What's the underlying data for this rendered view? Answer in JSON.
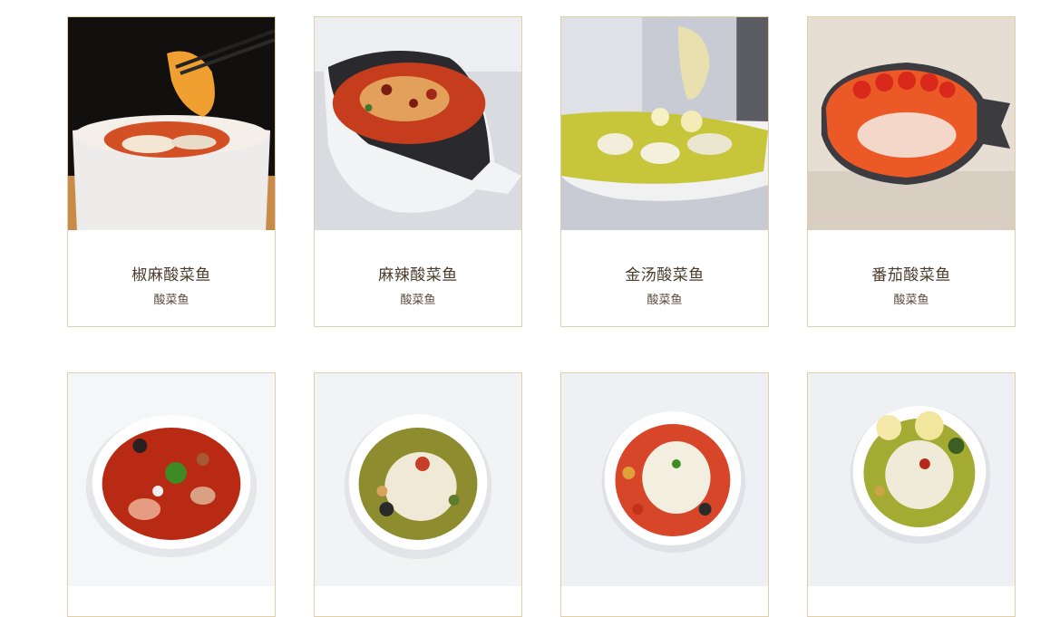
{
  "products": [
    {
      "title": "椒麻酸菜鱼",
      "subtitle": "酸菜鱼"
    },
    {
      "title": "麻辣酸菜鱼",
      "subtitle": "酸菜鱼"
    },
    {
      "title": "金汤酸菜鱼",
      "subtitle": "酸菜鱼"
    },
    {
      "title": "番茄酸菜鱼",
      "subtitle": "酸菜鱼"
    }
  ],
  "colors": {
    "card_border": "#e2cfa9",
    "title_text": "#4a3b2c"
  }
}
